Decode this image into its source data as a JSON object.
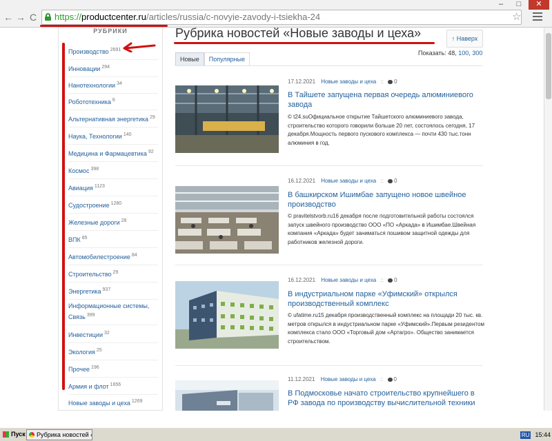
{
  "browser": {
    "url_proto": "https://",
    "url_host": "productcenter.ru",
    "url_path": "/articles/russia/c-novyie-zavody-i-tsiekha-24",
    "nav_back": "←",
    "nav_forward": "→",
    "nav_reload": "C",
    "star": "☆"
  },
  "sidebar": {
    "heading": "РУБРИКИ",
    "items": [
      {
        "label": "Производство",
        "count": "2691"
      },
      {
        "label": "Инновации",
        "count": "294"
      },
      {
        "label": "Нанотехнологии",
        "count": "34"
      },
      {
        "label": "Робототехника",
        "count": "6"
      },
      {
        "label": "Альтернативная энергетика",
        "count": "29"
      },
      {
        "label": "Наука, Технологии",
        "count": "140"
      },
      {
        "label": "Медицина и Фармацевтика",
        "count": "92"
      },
      {
        "label": "Космос",
        "count": "398"
      },
      {
        "label": "Авиация",
        "count": "1123"
      },
      {
        "label": "Судостроение",
        "count": "1280"
      },
      {
        "label": "Железные дороги",
        "count": "28"
      },
      {
        "label": "ВПК",
        "count": "85"
      },
      {
        "label": "Автомобилестроение",
        "count": "84"
      },
      {
        "label": "Строительство",
        "count": "29"
      },
      {
        "label": "Энергетика",
        "count": "937"
      },
      {
        "label": "Информационные системы, Связь",
        "count": "399"
      },
      {
        "label": "Инвестиции",
        "count": "32"
      },
      {
        "label": "Экология",
        "count": "25"
      },
      {
        "label": "Прочее",
        "count": "196"
      },
      {
        "label": "Армия и флот",
        "count": "1656"
      },
      {
        "label": "Новые заводы и цеха",
        "count": "1269"
      }
    ]
  },
  "main": {
    "title": "Рубрика новостей «Новые заводы и цеха»",
    "up_button": "↑ Наверх",
    "show_label": "Показать: 48,",
    "show_100": "100",
    "show_300": "300",
    "tabs": [
      {
        "label": "Новые"
      },
      {
        "label": "Популярные"
      }
    ],
    "articles": [
      {
        "date": "17.12.2021",
        "category": "Новые заводы и цеха",
        "sep": "::",
        "comments": "0",
        "title": "В Тайшете запущена первая очередь алюминиевого завода",
        "text": "© t24.suОфициальное открытие Тайшетского алюминиевого завода, строительство которого говорили больше 20 лет, состоялось сегодня, 17 декабря.Мощность первого пускового комплекса — почти 430 тыс.тонн алюминия в год."
      },
      {
        "date": "16.12.2021",
        "category": "Новые заводы и цеха",
        "sep": "::",
        "comments": "0",
        "title": "В башкирском Ишимбае запущено новое швейное производство",
        "text": "© pravitelstvorb.ru16 декабря после подготовительной работы состоялся запуск швейного производство ООО «ПО «Аркада» в Ишимбае.Швейная компания «Аркада» будет заниматься пошивом защитной одежды для работников железной дороги."
      },
      {
        "date": "16.12.2021",
        "category": "Новые заводы и цеха",
        "sep": "::",
        "comments": "0",
        "title": "В индустриальном парке «Уфимский» открылся производственный комплекс",
        "text": "© ufatime.ru15 декабря производственный комплекс на площади 20 тыс. кв. метров открылся в индустриальном парке «Уфимский».Первым резидентом комплекса стало ООО «Торговый дом «Артагро». Общество занимается строительством."
      },
      {
        "date": "11.12.2021",
        "category": "Новые заводы и цеха",
        "sep": "::",
        "comments": "0",
        "title": "В Подмосковье начато строительство крупнейшего в РФ завода по производству вычислительной техники",
        "text": ""
      }
    ]
  },
  "taskbar": {
    "start": "Пуск",
    "app": "Рубрика новостей «...",
    "lang": "RU",
    "clock": "15:44"
  },
  "colors": {
    "link": "#23609c",
    "annotation": "#d01010",
    "url_secure": "#2e9a2e"
  }
}
